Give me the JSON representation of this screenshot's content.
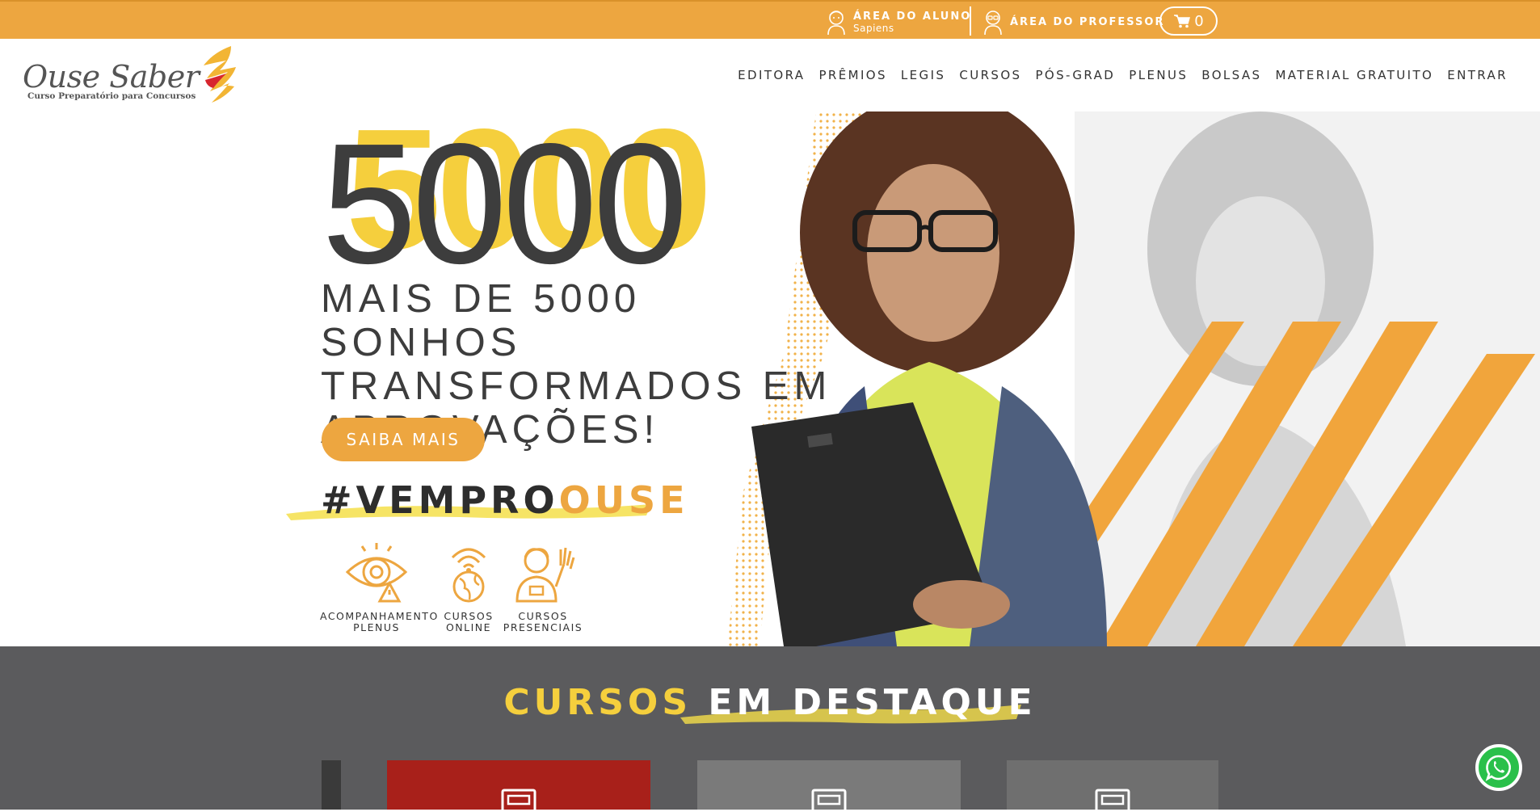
{
  "topbar": {
    "aluno_label": "ÁREA DO ALUNO",
    "aluno_sub": "Sapiens",
    "professor_label": "ÁREA DO PROFESSOR",
    "cart_count": "0"
  },
  "brand": {
    "name": "Ouse Saber",
    "tagline": "Curso Preparatório para Concursos"
  },
  "nav": [
    "EDITORA",
    "PRÊMIOS",
    "LEGIS",
    "CURSOS",
    "PÓS-GRAD",
    "PLENUS",
    "BOLSAS",
    "MATERIAL GRATUITO",
    "ENTRAR"
  ],
  "hero": {
    "big_number": "5000",
    "headline": [
      "MAIS DE 5000 SONHOS",
      "TRANSFORMADOS EM",
      "APROVAÇÕES!"
    ],
    "cta": "SAIBA MAIS",
    "hashtag_main": "#VEMPRO",
    "hashtag_accent": "OUSE",
    "features": [
      {
        "line1": "ACOMPANHAMENTO",
        "line2": "PLENUS"
      },
      {
        "line1": "CURSOS",
        "line2": "ONLINE"
      },
      {
        "line1": "CURSOS",
        "line2": "PRESENCIAIS"
      }
    ]
  },
  "featured": {
    "title_a": "CURSOS",
    "title_b": "EM DESTAQUE"
  },
  "colors": {
    "accent": "#eda640",
    "yellow": "#f5cf3d",
    "dark": "#3d3d3d",
    "section_bg": "#5b5b5d",
    "whatsapp": "#2ac04a"
  }
}
